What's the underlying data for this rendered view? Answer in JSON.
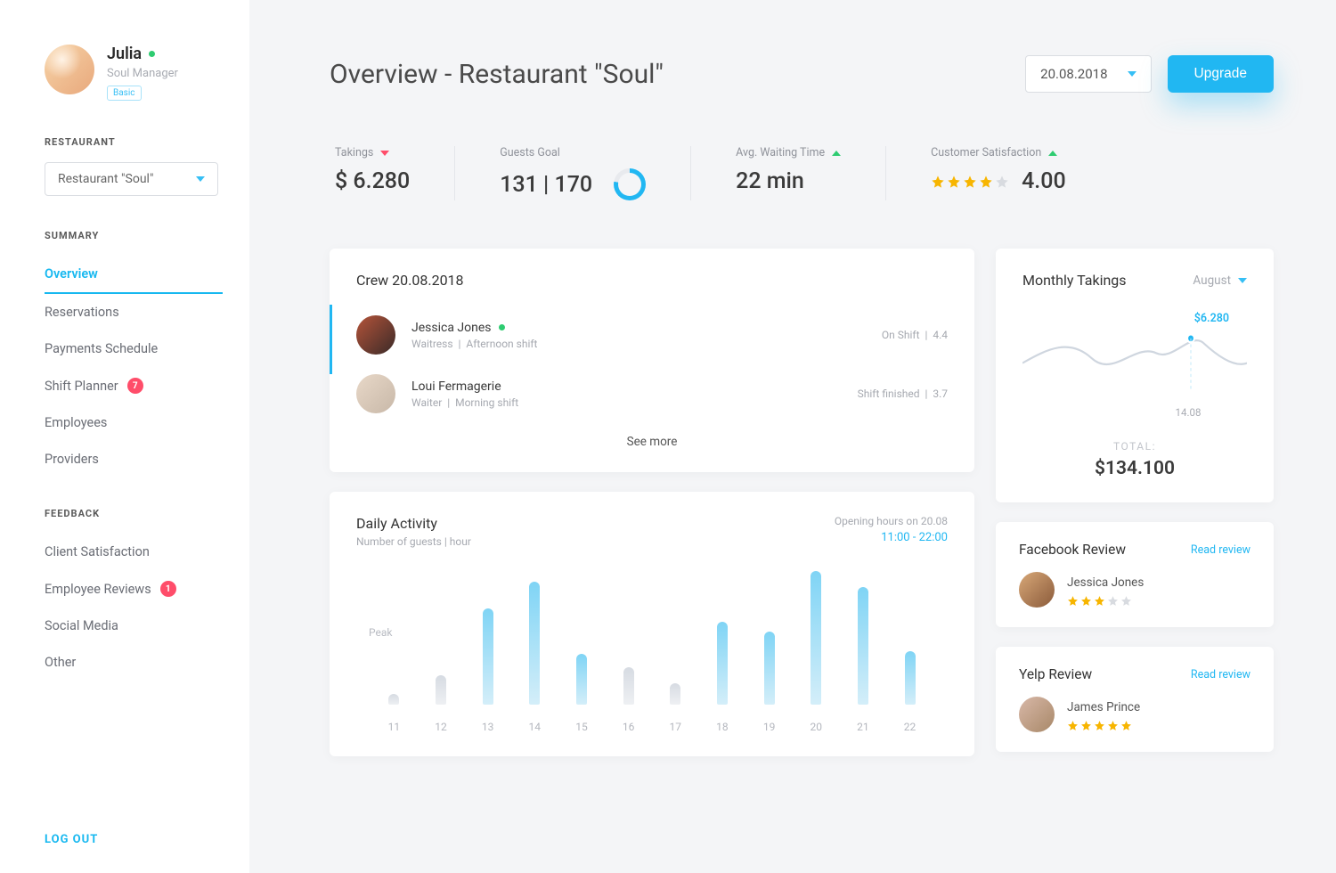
{
  "profile": {
    "name": "Julia",
    "role": "Soul Manager",
    "plan": "Basic"
  },
  "sidebar": {
    "restaurant_label": "RESTAURANT",
    "restaurant_selected": "Restaurant \"Soul\"",
    "summary_label": "SUMMARY",
    "summary_items": [
      {
        "label": "Overview",
        "active": true
      },
      {
        "label": "Reservations"
      },
      {
        "label": "Payments Schedule"
      },
      {
        "label": "Shift Planner",
        "badge": "7"
      },
      {
        "label": "Employees"
      },
      {
        "label": "Providers"
      }
    ],
    "feedback_label": "FEEDBACK",
    "feedback_items": [
      {
        "label": "Client Satisfaction"
      },
      {
        "label": "Employee Reviews",
        "badge": "1"
      },
      {
        "label": "Social Media"
      },
      {
        "label": "Other"
      }
    ],
    "logout": "LOG OUT"
  },
  "header": {
    "title": "Overview - Restaurant \"Soul\"",
    "date": "20.08.2018",
    "upgrade": "Upgrade"
  },
  "kpis": {
    "takings": {
      "label": "Takings",
      "value": "$ 6.280",
      "trend": "down"
    },
    "guests": {
      "label": "Guests Goal",
      "value": "131 | 170"
    },
    "waiting": {
      "label": "Avg. Waiting Time",
      "value": "22 min",
      "trend": "up"
    },
    "satisfaction": {
      "label": "Customer Satisfaction",
      "value": "4.00",
      "stars": 4,
      "trend": "up"
    }
  },
  "crew": {
    "title": "Crew 20.08.2018",
    "members": [
      {
        "name": "Jessica Jones",
        "role": "Waitress",
        "shift": "Afternoon shift",
        "status": "On Shift",
        "rating": "4.4",
        "online": true
      },
      {
        "name": "Loui Fermagerie",
        "role": "Waiter",
        "shift": "Morning shift",
        "status": "Shift finished",
        "rating": "3.7",
        "online": false
      }
    ],
    "see_more": "See more"
  },
  "daily": {
    "title": "Daily Activity",
    "subtitle": "Number of guests | hour",
    "hours_label": "Opening hours on 20.08",
    "hours_value": "11:00 - 22:00",
    "peak_label": "Peak"
  },
  "chart_data": {
    "type": "bar",
    "categories": [
      "11",
      "12",
      "13",
      "14",
      "15",
      "16",
      "17",
      "18",
      "19",
      "20",
      "21",
      "22"
    ],
    "values": [
      8,
      22,
      72,
      92,
      38,
      28,
      16,
      62,
      55,
      100,
      88,
      40
    ],
    "title": "Daily Activity",
    "xlabel": "hour",
    "ylabel": "Number of guests",
    "ylim": [
      0,
      100
    ]
  },
  "monthly": {
    "title": "Monthly Takings",
    "month_label": "August",
    "highlight_value": "$6.280",
    "highlight_date": "14.08",
    "total_label": "TOTAL:",
    "total_value": "$134.100"
  },
  "reviews": [
    {
      "source": "Facebook Review",
      "link": "Read review",
      "name": "Jessica Jones",
      "stars": 3
    },
    {
      "source": "Yelp Review",
      "link": "Read review",
      "name": "James Prince",
      "stars": 5
    }
  ]
}
